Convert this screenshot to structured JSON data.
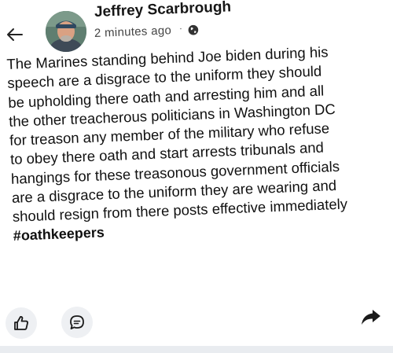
{
  "post": {
    "author": "Jeffrey Scarbrough",
    "timestamp": "2 minutes ago",
    "separator": "·",
    "privacy_icon": "globe-icon",
    "body_lines": [
      "The Marines standing behind Joe biden during his",
      "speech  are a disgrace to the uniform they should",
      "be upholding there oath and arresting  him and all",
      "the other treacherous politicians in Washington DC",
      "for treason any member of the military who refuse",
      "to obey there oath and start arrests  tribunals  and",
      "hangings for these treasonous government officials",
      "are a disgrace to the uniform they are wearing  and",
      "should resign from there posts effective immediately"
    ],
    "hashtag": "#oathkeepers"
  },
  "icons": {
    "back": "arrow-left-icon",
    "like": "thumbs-up-icon",
    "comment": "comment-bubble-icon",
    "share": "share-arrow-icon"
  },
  "colors": {
    "text": "#111111",
    "action_bg": "#eef0f3",
    "bottom_band": "#e9ecf0"
  }
}
